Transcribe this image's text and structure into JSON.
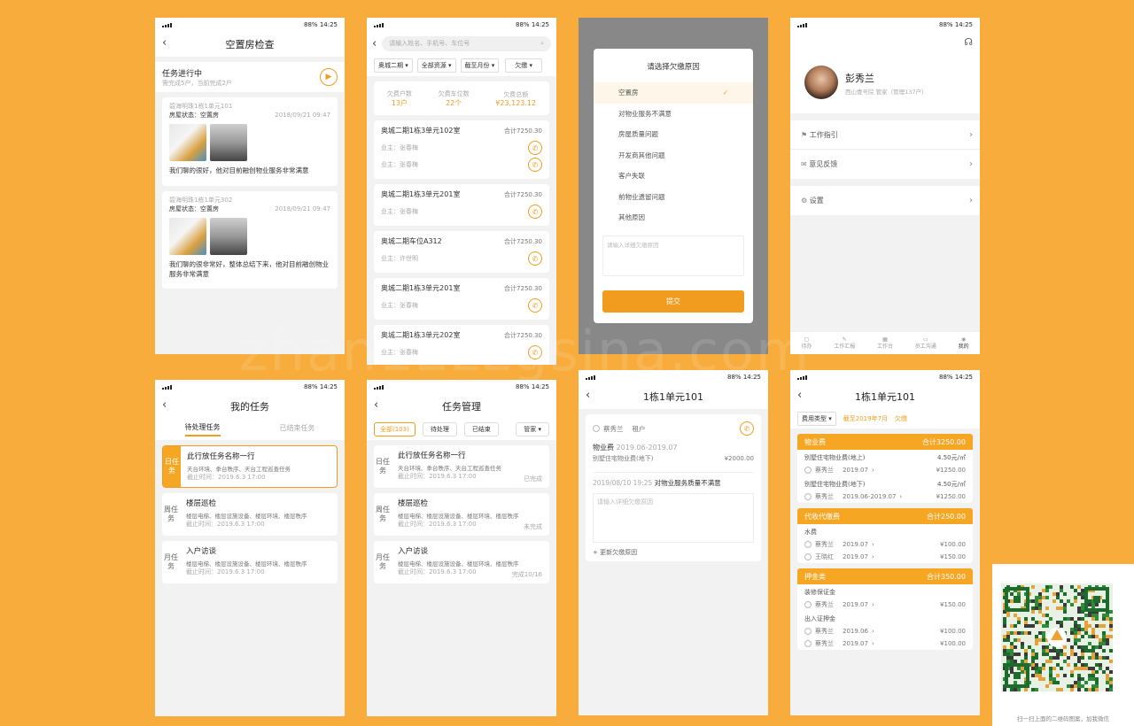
{
  "status": {
    "battery": "88%",
    "time": "14:25"
  },
  "p1": {
    "title": "空置房检查",
    "progress_title": "任务进行中",
    "progress_sub": "需完成5户，当前完成2户",
    "items": [
      {
        "addr": "碧海明珠1栋1单元101",
        "state": "房屋状态：空置房",
        "date": "2018/09/21 09:47",
        "text": "我们聊的很好，他对目前融创物业服务非常满意"
      },
      {
        "addr": "碧海明珠1栋1单元302",
        "state": "房屋状态：空置房",
        "date": "2018/09/21 09:47",
        "text": "我们聊的很非常好，整体总结下来，他对目前融创物业服务非常满意"
      }
    ]
  },
  "p2": {
    "search_placeholder": "请输入姓名、手机号、车位号",
    "filters": [
      "奥城二期",
      "全部资源",
      "截至月份",
      "欠缴"
    ],
    "stats": [
      {
        "label": "欠费户数",
        "value": "13户"
      },
      {
        "label": "欠费车位数",
        "value": "22个"
      },
      {
        "label": "欠费总额",
        "value": "¥23,123.12"
      }
    ],
    "items": [
      {
        "title": "奥城二期1栋3单元102室",
        "total": "合计7250.30",
        "owners": [
          "业主：张春梅",
          "业主：张春梅"
        ]
      },
      {
        "title": "奥城二期1栋3单元201室",
        "total": "合计7250.30",
        "owners": [
          "业主：张春梅"
        ]
      },
      {
        "title": "奥城二期车位A312",
        "total": "合计7250.30",
        "owners": [
          "业主：许世明"
        ]
      },
      {
        "title": "奥城二期1栋3单元201室",
        "total": "合计7250.30",
        "owners": [
          "业主：张春梅"
        ]
      },
      {
        "title": "奥城二期1栋3单元202室",
        "total": "合计7250.30",
        "owners": [
          "业主：张春梅"
        ]
      }
    ]
  },
  "p3": {
    "title": "请选择欠缴原因",
    "options": [
      "空置房",
      "对物业服务不满意",
      "房屋质量问题",
      "开发商其他问题",
      "客户失联",
      "前物业遗留问题",
      "其他原因"
    ],
    "selected": 0,
    "placeholder": "请输入详细欠缴原因",
    "submit": "提交"
  },
  "p4": {
    "name": "彭秀兰",
    "sub": "西山壹号院 管家（管理137户）",
    "menu": [
      "工作指引",
      "意见反馈",
      "设置"
    ],
    "tabs": [
      "待办",
      "工作汇报",
      "工作台",
      "员工沟通",
      "我的"
    ]
  },
  "p5": {
    "title": "我的任务",
    "tabs": [
      "待处理任务",
      "已结束任务"
    ],
    "tasks": [
      {
        "badge": "日任务",
        "title": "此行放任务名称一行",
        "desc": "天台环境、季台秩序、天台工程巡查任务",
        "time": "截止时间：2019.6.3 17:00"
      },
      {
        "badge": "周任务",
        "title": "楼层巡检",
        "desc": "楼层电梯、楼层设施设备、楼层环境、楼层秩序",
        "time": "截止时间：2019.6.3 17:00"
      },
      {
        "badge": "月任务",
        "title": "入户访谈",
        "desc": "楼层电梯、楼层设施设备、楼层环境、楼层秩序",
        "time": "截止时间：2019.6.3 17:00"
      }
    ]
  },
  "p6": {
    "title": "任务管理",
    "filters": [
      "全部(103)",
      "待处理",
      "已结束",
      "管家"
    ],
    "tasks": [
      {
        "badge": "日任务",
        "title": "此行放任务名称一行",
        "desc": "天台环境、季台秩序、天台工程巡查任务",
        "time": "截止时间：2019.6.3 17:00",
        "status": "已完成"
      },
      {
        "badge": "周任务",
        "title": "楼层巡检",
        "desc": "楼层电梯、楼层设施设备、楼层环境、楼层秩序",
        "time": "截止时间：2019.6.3 17:00",
        "status": "未完成"
      },
      {
        "badge": "月任务",
        "title": "入户访谈",
        "desc": "楼层电梯、楼层设施设备、楼层环境、楼层秩序",
        "time": "截止时间：2019.6.3 17:00",
        "status": "完成10/16"
      }
    ]
  },
  "p7": {
    "title": "1栋1单元101",
    "person": "蔡秀兰",
    "role": "租户",
    "fee_name": "物业费",
    "fee_period": "2019.06-2019.07",
    "fee_item": "别墅住宅物业费(地下)",
    "fee_amount": "¥2000.00",
    "record_date": "2019/08/10",
    "record_time": "19:25",
    "record_text": "对物业服务质量不满意",
    "placeholder": "请输入详细欠缴原因",
    "update": "更新欠缴原因"
  },
  "p8": {
    "title": "1栋1单元101",
    "filter": "费用类型",
    "cutoff": "截至2019年7月",
    "tag": "欠缴",
    "sections": [
      {
        "name": "物业费",
        "total": "合计3250.00",
        "items": [
          {
            "name": "别墅住宅物业费(地上)",
            "rate": "4.50元/㎡",
            "payers": [
              {
                "n": "蔡秀兰",
                "p": "2019.07",
                "a": "¥1250.00"
              }
            ]
          },
          {
            "name": "别墅住宅物业费(地下)",
            "rate": "4.50元/㎡",
            "payers": [
              {
                "n": "蔡秀兰",
                "p": "2019.06-2019.07",
                "a": "¥1250.00"
              }
            ]
          }
        ]
      },
      {
        "name": "代收代缴费",
        "total": "合计250.00",
        "items": [
          {
            "name": "水费",
            "rate": "",
            "payers": [
              {
                "n": "蔡秀兰",
                "p": "2019.07",
                "a": "¥100.00"
              },
              {
                "n": "王晓红",
                "p": "2019.07",
                "a": "¥150.00"
              }
            ]
          }
        ]
      },
      {
        "name": "押金类",
        "total": "合计350.00",
        "items": [
          {
            "name": "装修保证金",
            "rate": "",
            "payers": [
              {
                "n": "蔡秀兰",
                "p": "2019.07",
                "a": "¥150.00"
              }
            ]
          },
          {
            "name": "出入证押金",
            "rate": "",
            "payers": [
              {
                "n": "蔡秀兰",
                "p": "2019.06",
                "a": "¥100.00"
              },
              {
                "n": "蔡秀兰",
                "p": "2019.07",
                "a": "¥100.00"
              }
            ]
          }
        ]
      }
    ]
  },
  "qr_caption": "扫一扫上面的二维码图案，加我微信",
  "watermark": "zhan12zzgsina.com"
}
